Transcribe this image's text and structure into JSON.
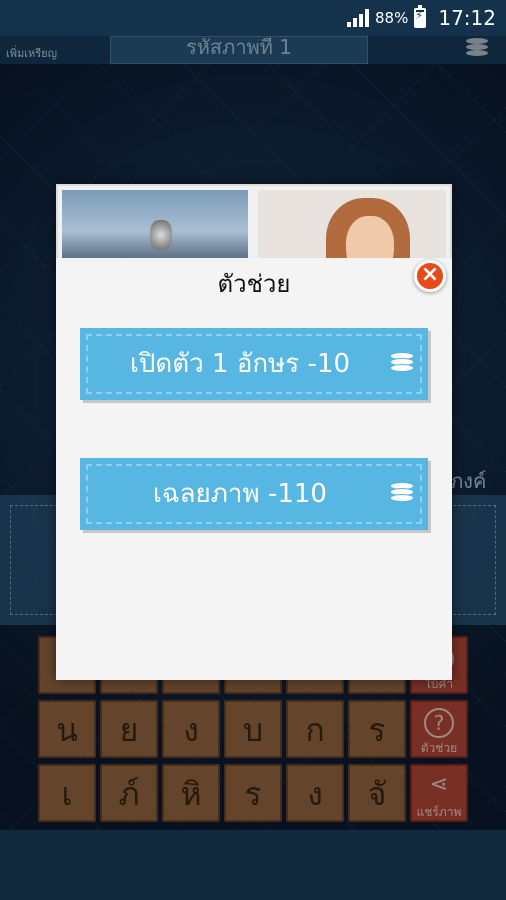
{
  "status_bar": {
    "battery_percent": "88%",
    "time": "17:12",
    "battery_level": 0.88
  },
  "header": {
    "left_label": "เพิ่มเหรียญ",
    "title": "รหัสภาพที่ 1"
  },
  "background": {
    "side_text": "ภงค์"
  },
  "keyboard": {
    "row1": [
      "",
      "",
      "",
      "",
      "",
      ""
    ],
    "row2": [
      "น",
      "ย",
      "ง",
      "บ",
      "ก",
      "ร"
    ],
    "row3": [
      "เ",
      "ภ์",
      "หิ",
      "ร",
      "ง",
      "จั"
    ],
    "side_keys": [
      {
        "label": "ใบ้คำ",
        "icon": "hint-icon"
      },
      {
        "label": "ตัวช่วย",
        "icon": "question-icon"
      },
      {
        "label": "แชร์ภาพ",
        "icon": "share-icon"
      }
    ]
  },
  "dialog": {
    "title": "ตัวช่วย",
    "close_icon": "close-icon",
    "options": [
      {
        "label": "เปิดตัว 1 อักษร -10",
        "icon": "coins-icon"
      },
      {
        "label": "เฉลยภาพ -110",
        "icon": "coins-icon"
      }
    ]
  },
  "colors": {
    "hint_button": "#58b6e2",
    "close_button": "#e64a19",
    "key_tile": "#9a6a42",
    "side_key": "#b94a3a"
  }
}
